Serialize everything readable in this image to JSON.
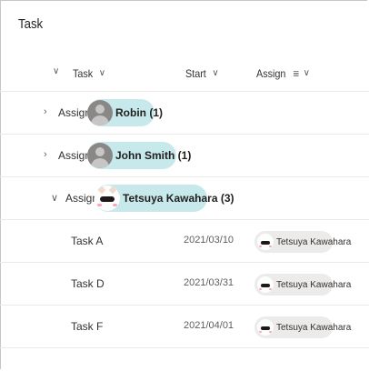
{
  "title": "Task",
  "columns": {
    "task": "Task",
    "start": "Start",
    "assign": "Assign"
  },
  "groups": [
    {
      "prefix": "Assign :",
      "name": "Robin (1)",
      "expanded": false,
      "avatar": "person-placeholder-icon"
    },
    {
      "prefix": "Assign :",
      "name": "John Smith (1)",
      "expanded": false,
      "avatar": "person-placeholder-icon"
    },
    {
      "prefix": "Assign :",
      "name": "Tetsuya Kawahara (3)",
      "expanded": true,
      "avatar": "cat-avatar-icon"
    }
  ],
  "rows": [
    {
      "task": "Task A",
      "start": "2021/03/10",
      "assign": "Tetsuya Kawahara"
    },
    {
      "task": "Task D",
      "start": "2021/03/31",
      "assign": "Tetsuya Kawahara"
    },
    {
      "task": "Task F",
      "start": "2021/04/01",
      "assign": "Tetsuya Kawahara"
    }
  ],
  "colors": {
    "pill": "#c7e9ec",
    "chip": "#edebe9",
    "divider": "#edebe9"
  }
}
